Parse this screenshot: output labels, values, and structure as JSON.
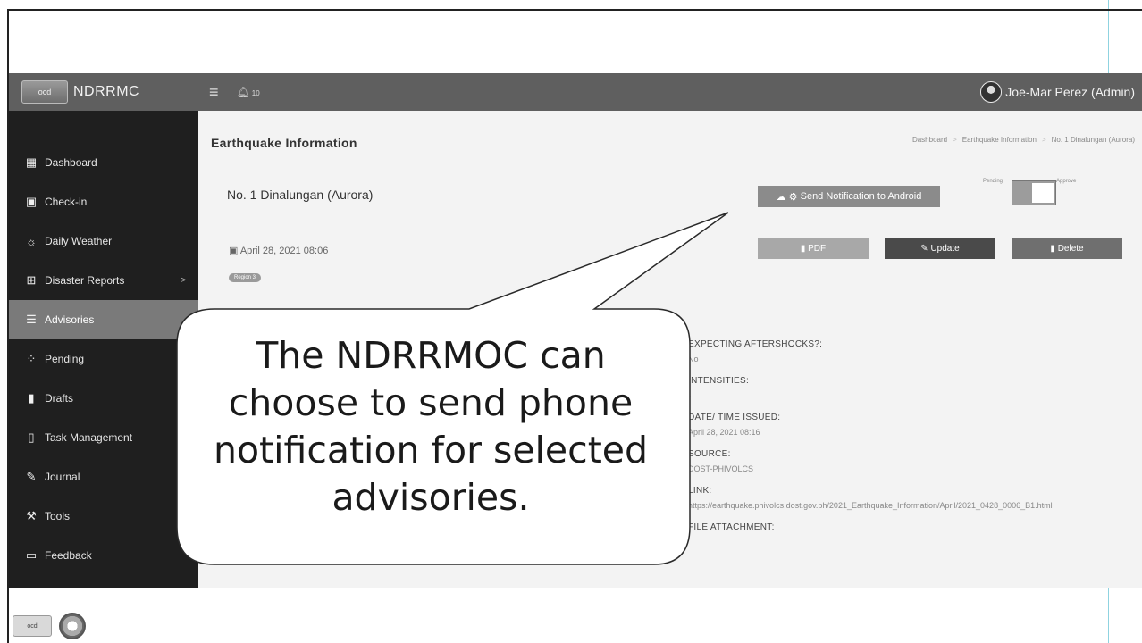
{
  "app": {
    "brand": "NDRRMC",
    "logo_text": "ocd",
    "bell_count": "10",
    "user_name": "Joe-Mar Perez (Admin)"
  },
  "sidebar": {
    "items": [
      {
        "label": "Dashboard",
        "icon": "dashboard-icon"
      },
      {
        "label": "Check-in",
        "icon": "calendar-check-icon"
      },
      {
        "label": "Daily Weather",
        "icon": "weather-icon"
      },
      {
        "label": "Disaster Reports",
        "icon": "sitemap-icon",
        "arrow": ">"
      },
      {
        "label": "Advisories",
        "icon": "list-icon",
        "active": true
      },
      {
        "label": "Pending",
        "icon": "spinner-icon"
      },
      {
        "label": "Drafts",
        "icon": "file-icon"
      },
      {
        "label": "Task Management",
        "icon": "clipboard-icon"
      },
      {
        "label": "Journal",
        "icon": "edit-icon"
      },
      {
        "label": "Tools",
        "icon": "wrench-icon"
      },
      {
        "label": "Feedback",
        "icon": "comment-icon"
      }
    ]
  },
  "page": {
    "title": "Earthquake Information",
    "breadcrumb": [
      "Dashboard",
      "Earthquake Information",
      "No. 1 Dinalungan (Aurora)"
    ]
  },
  "record": {
    "title": "No. 1 Dinalungan (Aurora)",
    "date": "April 28, 2021 08:06",
    "region": "Region 3"
  },
  "actions": {
    "notify_label": "Send Notification to Android",
    "pdf_label": "PDF",
    "update_label": "Update",
    "delete_label": "Delete",
    "toggle_left": "Pending",
    "toggle_right": "Approve"
  },
  "details": {
    "aftershocks_label": "EXPECTING AFTERSHOCKS?:",
    "aftershocks_value": "No",
    "intensities_label": "INTENSITIES:",
    "intensities_value": "-",
    "issued_label": "DATE/ TIME ISSUED:",
    "issued_value": "April 28, 2021 08:16",
    "source_label": "SOURCE:",
    "source_value": "DOST-PHIVOLCS",
    "link_label": "LINK:",
    "link_value": "https://earthquake.phivolcs.dost.gov.ph/2021_Earthquake_Information/April/2021_0428_0006_B1.html",
    "attachment_label": "FILE ATTACHMENT:"
  },
  "callout": {
    "text": "The NDRRMOC can choose to send phone notification for selected advisories."
  },
  "footer": {
    "logo_text": "ocd"
  }
}
